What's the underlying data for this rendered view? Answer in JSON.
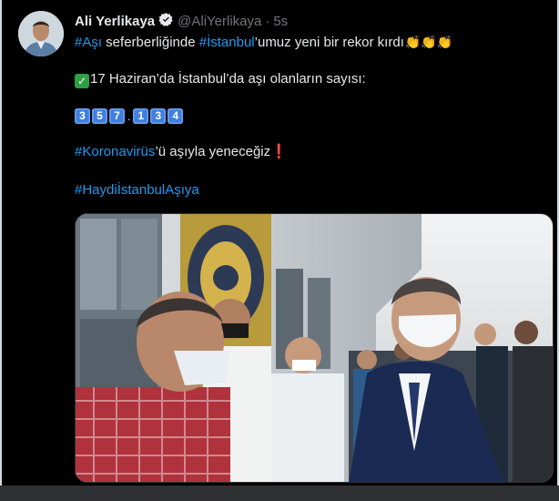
{
  "tweet": {
    "author_name": "Ali Yerlikaya",
    "handle": "@AliYerlikaya",
    "separator": "·",
    "timestamp": "5s",
    "lines": {
      "l1_tag1": "#Aşı",
      "l1_text1": " seferberliğinde ",
      "l1_tag2": "#İstanbul",
      "l1_text2": "’umuz yeni bir rekor kırdı",
      "clap": "👏👏👏",
      "l2_text": "17 Haziran’da İstanbul’da aşı olanların sayısı:",
      "count_digits": [
        "3",
        "5",
        "7",
        "1",
        "3",
        "4"
      ],
      "count_separator": ".",
      "l4_tag": "#Koronavirüs",
      "l4_text": "’ü aşıyla yeneceğiz",
      "l4_excl": "❗",
      "l5_tag": "#HaydiİstanbulAşıya"
    }
  },
  "icons": [
    "verified-badge-icon",
    "check-mark-emoji-icon",
    "clapping-hands-emoji-icon",
    "exclamation-emoji-icon"
  ],
  "colors": {
    "background": "#000000",
    "link": "#1d9bf0",
    "text": "#e7e9ea",
    "muted": "#71767b",
    "keycap": "#3f7fe0"
  }
}
